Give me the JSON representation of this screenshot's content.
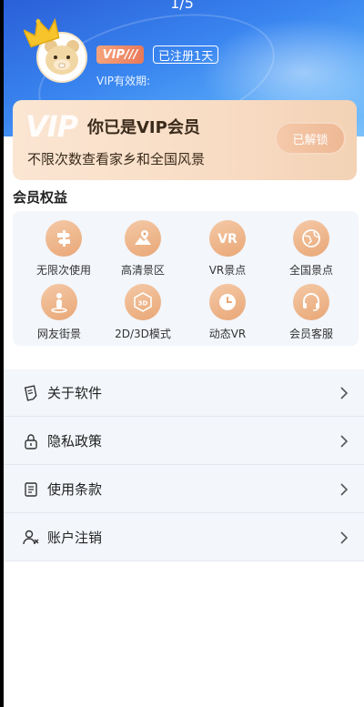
{
  "header": {
    "page_indicator": "1/5",
    "vip_badge": "VIP///",
    "registered_badge": "已注册1天",
    "vip_expiry": "VIP有效期:"
  },
  "vip_card": {
    "logo": "VIP",
    "title": "你已是VIP会员",
    "subtitle": "不限次数查看家乡和全国风景",
    "unlock_button": "已解锁"
  },
  "benefits": {
    "title": "会员权益",
    "items": [
      {
        "label": "无限次使用",
        "icon": "signpost-icon"
      },
      {
        "label": "高清景区",
        "icon": "map-icon"
      },
      {
        "label": "VR景点",
        "icon": "vr-icon"
      },
      {
        "label": "全国景点",
        "icon": "globe-icon"
      },
      {
        "label": "网友街景",
        "icon": "location-person-icon"
      },
      {
        "label": "2D/3D模式",
        "icon": "cube-3d-icon"
      },
      {
        "label": "动态VR",
        "icon": "clock-icon"
      },
      {
        "label": "会员客服",
        "icon": "headset-icon"
      }
    ]
  },
  "menu": {
    "items": [
      {
        "label": "关于软件",
        "icon": "document-hand-icon"
      },
      {
        "label": "隐私政策",
        "icon": "lock-icon"
      },
      {
        "label": "使用条款",
        "icon": "document-icon"
      },
      {
        "label": "账户注销",
        "icon": "user-remove-icon"
      }
    ]
  },
  "colors": {
    "header_blue": "#3a86f0",
    "vip_gold": "#e9a777",
    "panel_bg": "#f3f6fb"
  }
}
